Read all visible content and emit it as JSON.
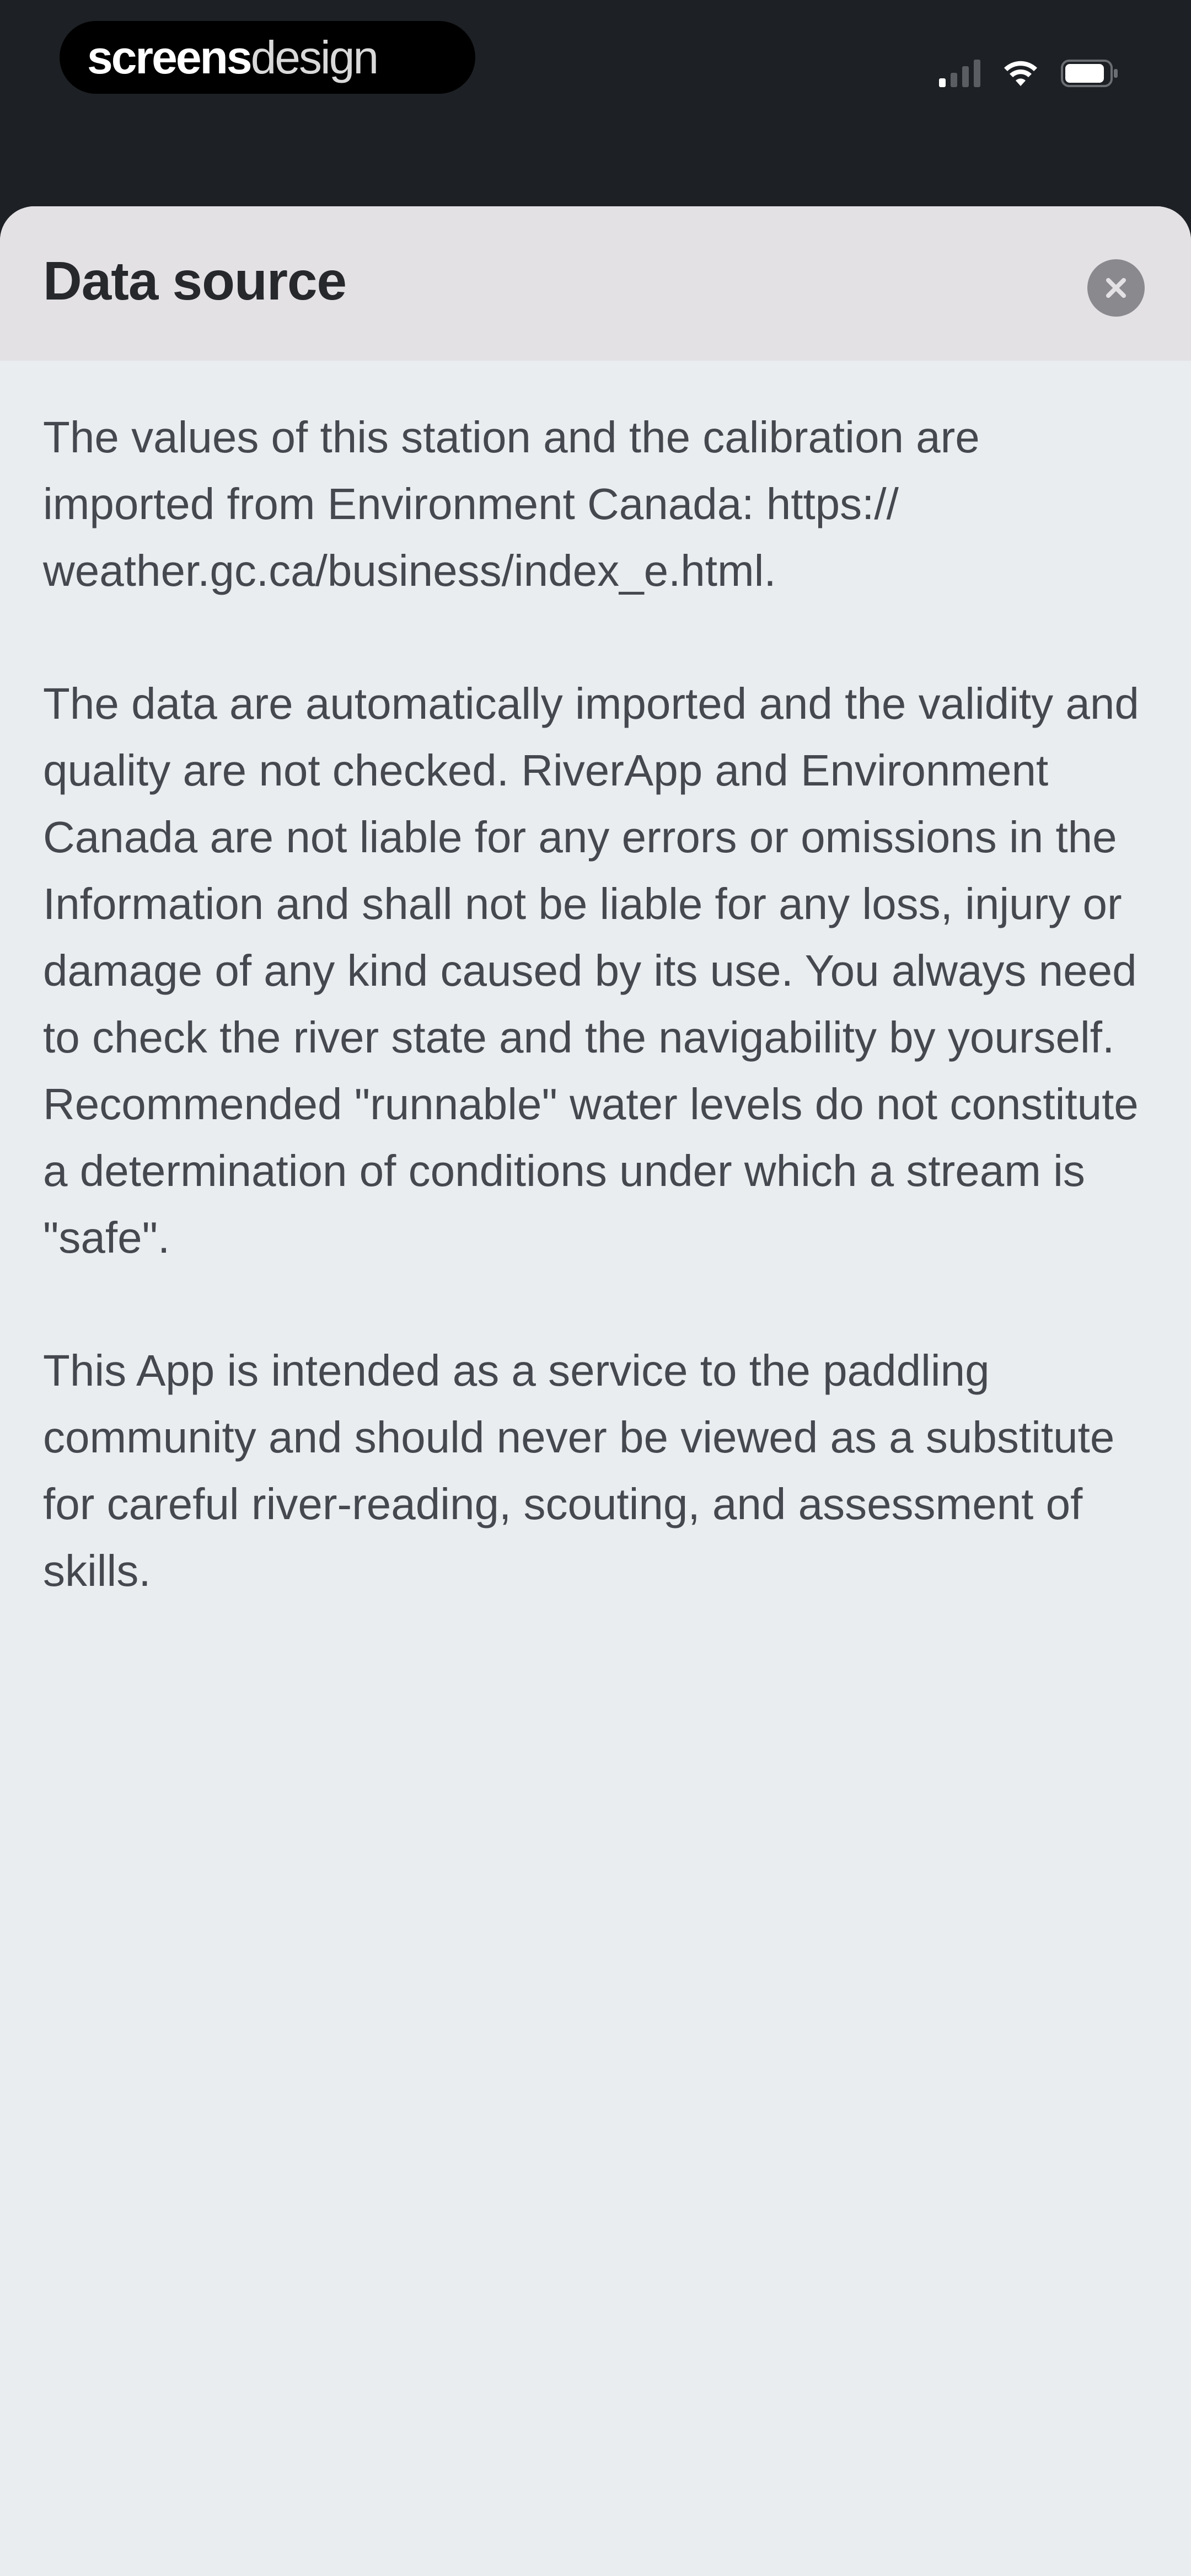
{
  "status_bar": {
    "brand_bold": "screens",
    "brand_light": "design",
    "icons": [
      "cellular-signal-icon",
      "wifi-icon",
      "battery-icon"
    ]
  },
  "sheet": {
    "title": "Data source",
    "close_icon": "close-icon",
    "paragraphs": [
      "The values of this station and the calibration are imported from Environment Canada: https:// weather.gc.ca/business/index_e.html.",
      "The data are automatically imported and the validity and quality are not checked. RiverApp and Environment Canada are not liable for any errors or omissions in the Information and shall not be liable for any loss, injury or damage of any kind caused by its use. You always need to check the river state and the navigability by yourself. Recommended \"runnable\" water levels do not constitute a determination of conditions under which a stream is \"safe\".",
      "This App is intended as a service to the paddling community and should never be viewed as a substitute for careful river-reading, scouting, and assessment of skills."
    ]
  },
  "colors": {
    "status_bar_bg": "#1d2024",
    "sheet_bg": "#e9edf0",
    "header_bg": "#e4e1e5",
    "title_text": "#26282c",
    "body_text": "#45484e",
    "close_button": "#8a898d"
  }
}
